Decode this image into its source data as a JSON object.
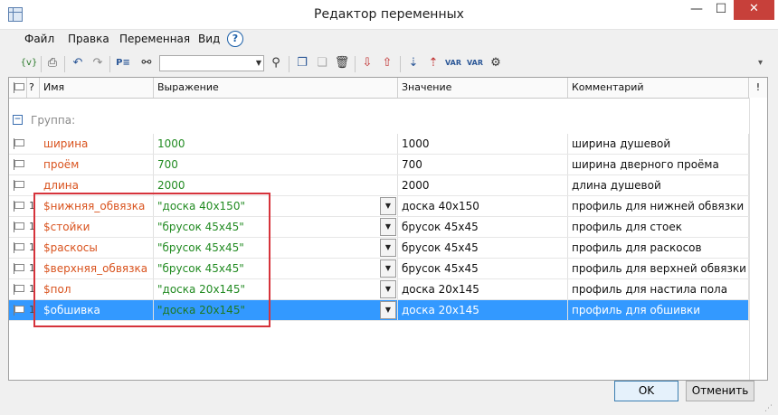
{
  "window": {
    "title": "Редактор переменных",
    "minimize_glyph": "—",
    "maximize_glyph": "☐",
    "close_glyph": "✕"
  },
  "menu": {
    "items": [
      "Файл",
      "Правка",
      "Переменная",
      "Вид"
    ],
    "help_glyph": "?"
  },
  "toolbar": {
    "search": {
      "value": "",
      "placeholder": ""
    },
    "icons": [
      "add-variable-icon",
      "print-icon",
      "undo-icon",
      "redo-icon",
      "properties-icon",
      "find-icon",
      "search-go-icon",
      "copy-icon",
      "paste-icon",
      "delete-icon",
      "import-icon",
      "export-icon",
      "sort-icon",
      "sort-desc-icon",
      "insert-var-icon",
      "insert-var-alt-icon",
      "settings-icon"
    ]
  },
  "table": {
    "columns": {
      "check": "?",
      "name": "Имя",
      "expression": "Выражение",
      "value": "Значение",
      "comment": "Комментарий",
      "warning": "!"
    },
    "group_label": "Группа:",
    "group_toggle": "−",
    "rows": [
      {
        "mark": "",
        "name": "ширина",
        "expression": "1000",
        "value": "1000",
        "comment": "ширина душевой",
        "has_dropdown": false,
        "selected": false
      },
      {
        "mark": "",
        "name": "проём",
        "expression": "700",
        "value": "700",
        "comment": "ширина дверного проёма",
        "has_dropdown": false,
        "selected": false
      },
      {
        "mark": "",
        "name": "длина",
        "expression": "2000",
        "value": "2000",
        "comment": "длина душевой",
        "has_dropdown": false,
        "selected": false
      },
      {
        "mark": "1",
        "name": "$нижняя_обвязка",
        "expression": "\"доска 40х150\"",
        "value": "доска 40х150",
        "comment": "профиль для нижней обвязки",
        "has_dropdown": true,
        "selected": false
      },
      {
        "mark": "1",
        "name": "$стойки",
        "expression": "\"брусок 45х45\"",
        "value": "брусок 45х45",
        "comment": "профиль для стоек",
        "has_dropdown": true,
        "selected": false
      },
      {
        "mark": "1",
        "name": "$раскосы",
        "expression": "\"брусок 45х45\"",
        "value": "брусок 45х45",
        "comment": "профиль для раскосов",
        "has_dropdown": true,
        "selected": false
      },
      {
        "mark": "1",
        "name": "$верхняя_обвязка",
        "expression": "\"брусок 45х45\"",
        "value": "брусок 45х45",
        "comment": "профиль для верхней обвязки",
        "has_dropdown": true,
        "selected": false
      },
      {
        "mark": "1",
        "name": "$пол",
        "expression": "\"доска 20х145\"",
        "value": "доска 20х145",
        "comment": "профиль для настила пола",
        "has_dropdown": true,
        "selected": false
      },
      {
        "mark": "1",
        "name": "$обшивка",
        "expression": "\"доска 20х145\"",
        "value": "доска 20х145",
        "comment": "профиль для обшивки",
        "has_dropdown": true,
        "selected": true
      }
    ]
  },
  "buttons": {
    "ok": "OK",
    "cancel": "Отменить"
  },
  "colors": {
    "name_text": "#d9531e",
    "expression_text": "#228b22",
    "selection": "#3399ff",
    "highlight_box": "#d6333b",
    "close_button": "#c7403a"
  }
}
